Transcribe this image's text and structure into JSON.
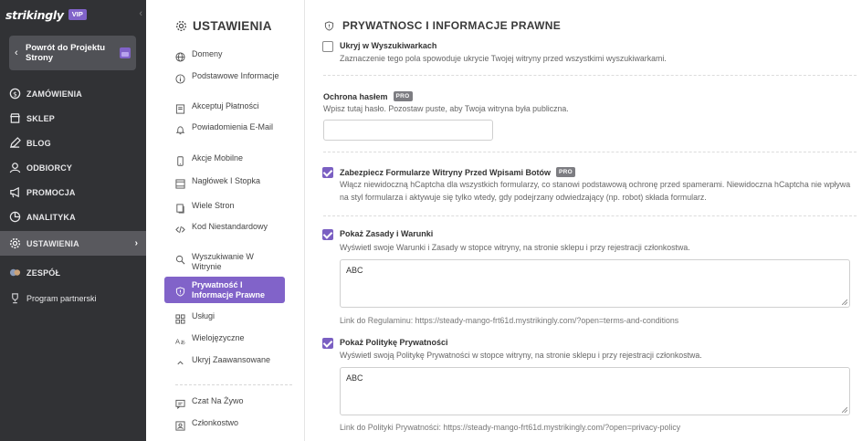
{
  "sidebar": {
    "brand": "strikingly",
    "vip_badge": "VIP",
    "back_button": "Powrót do Projektu Strony",
    "items": [
      {
        "label": "ZAMÓWIENIA",
        "icon": "orders-icon"
      },
      {
        "label": "SKLEP",
        "icon": "store-icon"
      },
      {
        "label": "BLOG",
        "icon": "blog-icon"
      },
      {
        "label": "ODBIORCY",
        "icon": "audience-icon"
      },
      {
        "label": "PROMOCJA",
        "icon": "promotion-icon"
      },
      {
        "label": "ANALITYKA",
        "icon": "analytics-icon"
      },
      {
        "label": "USTAWIENIA",
        "icon": "gear-icon",
        "active": true
      },
      {
        "label": "ZESPÓŁ",
        "icon": "team-icon"
      },
      {
        "label": "Program partnerski",
        "icon": "trophy-icon"
      }
    ]
  },
  "subnav": {
    "title": "USTAWIENIA",
    "items": [
      {
        "label": "Domeny",
        "icon": "globe-icon"
      },
      {
        "label": "Podstawowe Informacje",
        "icon": "info-icon"
      },
      {
        "label": "Akceptuj Płatności",
        "icon": "payment-icon"
      },
      {
        "label": "Powiadomienia E-Mail",
        "icon": "bell-icon"
      },
      {
        "label": "Akcje Mobilne",
        "icon": "mobile-icon"
      },
      {
        "label": "Nagłówek I Stopka",
        "icon": "header-footer-icon"
      },
      {
        "label": "Wiele Stron",
        "icon": "pages-icon"
      },
      {
        "label": "Kod Niestandardowy",
        "icon": "code-icon"
      },
      {
        "label": "Wyszukiwanie W Witrynie",
        "icon": "search-icon"
      },
      {
        "label": "Prywatność I Informacje Prawne",
        "icon": "shield-icon",
        "active": true
      },
      {
        "label": "Usługi",
        "icon": "services-icon"
      },
      {
        "label": "Wielojęzyczne",
        "icon": "translate-icon"
      },
      {
        "label": "Ukryj Zaawansowane",
        "icon": "chevron-up-icon"
      },
      {
        "label": "Czat Na Żywo",
        "icon": "chat-icon"
      },
      {
        "label": "Członkostwo",
        "icon": "membership-icon"
      }
    ]
  },
  "main": {
    "title": "PRYWATNOSC I INFORMACJE PRAWNE",
    "hide_search": {
      "checked": false,
      "label": "Ukryj w Wyszukiwarkach",
      "desc": "Zaznaczenie tego pola spowoduje ukrycie Twojej witryny przed wszystkimi wyszukiwarkami."
    },
    "password": {
      "label": "Ochrona hasłem",
      "badge": "PRO",
      "desc": "Wpisz tutaj hasło. Pozostaw puste, aby Twoja witryna była publiczna.",
      "value": ""
    },
    "bot_protection": {
      "checked": true,
      "label": "Zabezpiecz Formularze Witryny Przed Wpisami Botów",
      "badge": "PRO",
      "desc": "Włącz niewidoczną hCaptcha dla wszystkich formularzy, co stanowi podstawową ochronę przed spamerami. Niewidoczna hCaptcha nie wpływa na styl formularza i aktywuje się tylko wtedy, gdy podejrzany odwiedzający (np. robot) składa formularz."
    },
    "terms": {
      "checked": true,
      "label": "Pokaż Zasady i Warunki",
      "desc": "Wyświetl swoje Warunki i Zasady w stopce witryny, na stronie sklepu i przy rejestracji członkostwa.",
      "text": "ABC",
      "link": "Link do Regulaminu: https://steady-mango-frt61d.mystrikingly.com/?open=terms-and-conditions"
    },
    "privacy": {
      "checked": true,
      "label": "Pokaż Politykę Prywatności",
      "desc": "Wyświetl swoją Politykę Prywatności w stopce witryny, na stronie sklepu i przy rejestracji członkostwa.",
      "text": "ABC",
      "link": "Link do Polityki Prywatności: https://steady-mango-frt61d.mystrikingly.com/?open=privacy-policy"
    }
  },
  "colors": {
    "sidebar_bg": "#313235",
    "accent": "#8163c9",
    "active_nav": "#59595e"
  }
}
